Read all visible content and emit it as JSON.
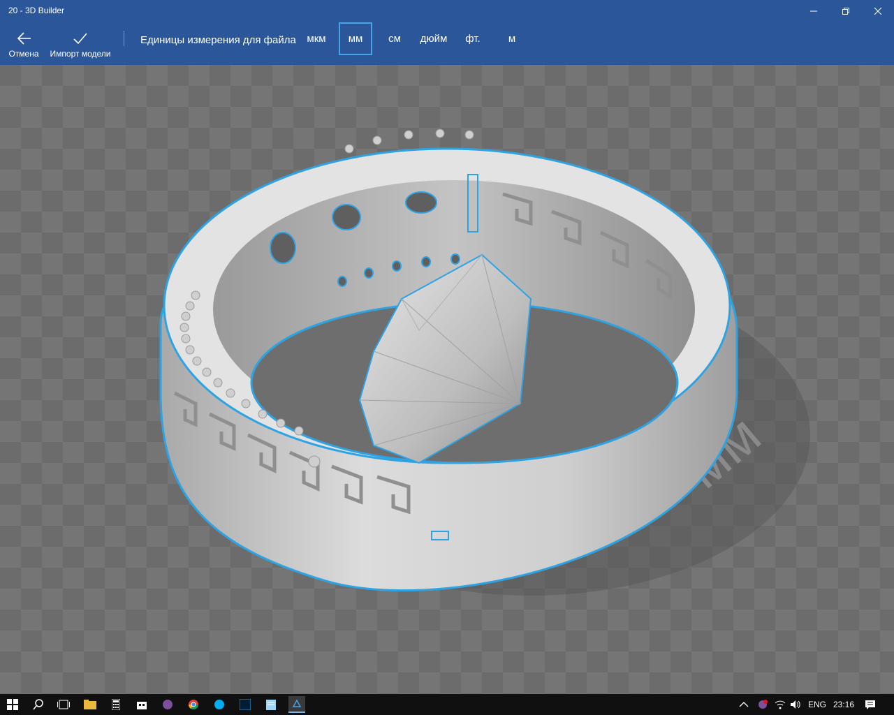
{
  "window": {
    "title": "20 - 3D Builder",
    "minimize_icon": "minimize-icon",
    "maximize_icon": "restore-icon",
    "close_icon": "close-icon"
  },
  "toolbar": {
    "cancel_label": "Отмена",
    "import_label": "Импорт модели",
    "units_label": "Единицы измерения для файла",
    "units": [
      "мкм",
      "мм",
      "см",
      "дюйм",
      "фт.",
      "м"
    ],
    "selected_unit": "мм"
  },
  "viewport": {
    "watermark_text": "мм",
    "selection_color": "#2ea3e3",
    "model_color": "#d8d8d8"
  },
  "taskbar": {
    "apps": [
      "start-icon",
      "search-icon",
      "task-view-icon",
      "file-explorer-icon",
      "calculator-icon",
      "store-icon",
      "viber-icon",
      "chrome-icon",
      "skype-icon",
      "photoshop-icon",
      "notepad-icon",
      "3d-builder-icon"
    ],
    "language": "ENG",
    "time": "23:16"
  },
  "colors": {
    "accent": "#2b579a",
    "selection": "#2ea3e3",
    "taskbar": "#101010"
  }
}
